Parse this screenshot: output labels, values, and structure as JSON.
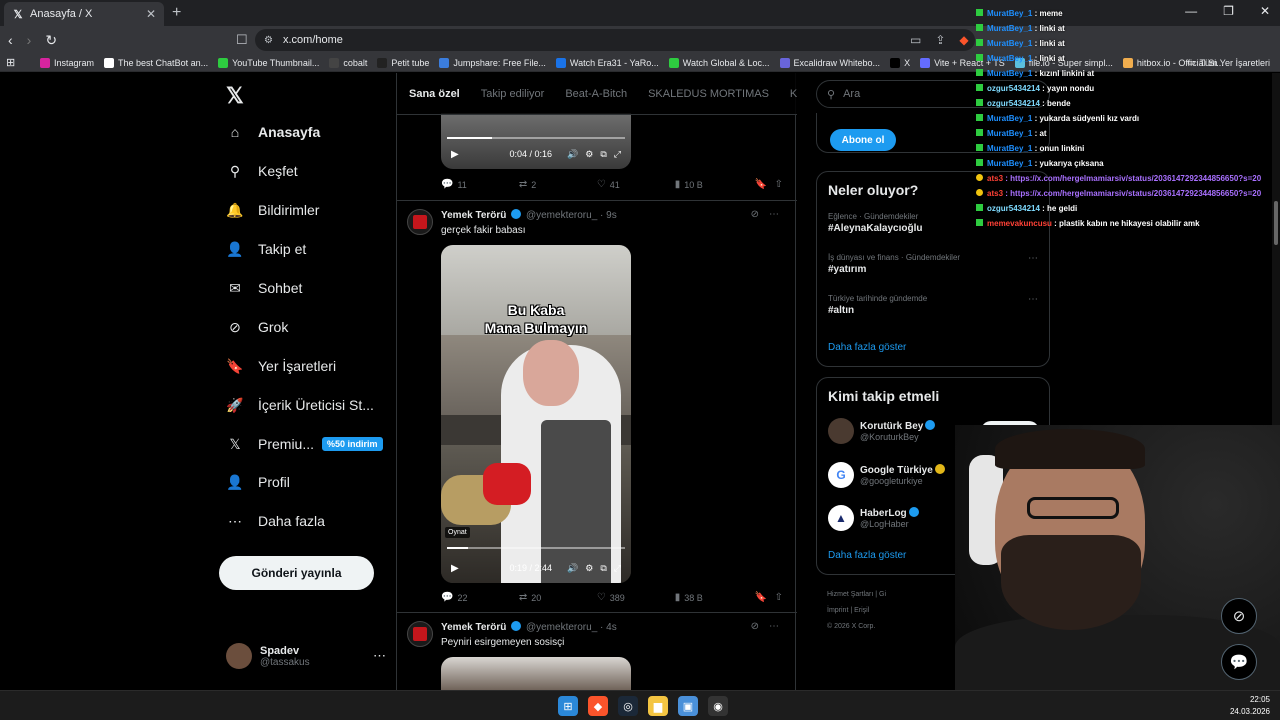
{
  "browser": {
    "tab_title": "Anasayfa / X",
    "url": "x.com/home",
    "bookmarks": [
      {
        "label": "Instagram",
        "color": "#d6249f"
      },
      {
        "label": "The best ChatBot an...",
        "color": "#ffffff"
      },
      {
        "label": "YouTube Thumbnail...",
        "color": "#2ecc40"
      },
      {
        "label": "cobalt",
        "color": "#444444"
      },
      {
        "label": "Petit tube",
        "color": "#222222"
      },
      {
        "label": "Jumpshare: Free File...",
        "color": "#3b7ddd"
      },
      {
        "label": "Watch Era31 - YaRo...",
        "color": "#1a73e8"
      },
      {
        "label": "Watch Global & Loc...",
        "color": "#2ecc40"
      },
      {
        "label": "Excalidraw Whitebo...",
        "color": "#6965db"
      },
      {
        "label": "X",
        "color": "#000000"
      },
      {
        "label": "Vite + React + TS",
        "color": "#646cff"
      },
      {
        "label": "file.io - Super simpl...",
        "color": "#5bc0de"
      },
      {
        "label": "hitbox.io - Official Si...",
        "color": "#f0ad4e"
      }
    ],
    "bookmarks_folder": "Tüm Yer İşaretleri"
  },
  "nav": {
    "items": [
      {
        "label": "Anasayfa",
        "icon": "home-icon",
        "glyph": "⌂"
      },
      {
        "label": "Keşfet",
        "icon": "search-icon",
        "glyph": "⚲"
      },
      {
        "label": "Bildirimler",
        "icon": "bell-icon",
        "glyph": "🔔"
      },
      {
        "label": "Takip et",
        "icon": "follow-icon",
        "glyph": "👤"
      },
      {
        "label": "Sohbet",
        "icon": "mail-icon",
        "glyph": "✉"
      },
      {
        "label": "Grok",
        "icon": "grok-icon",
        "glyph": "⊘"
      },
      {
        "label": "Yer İşaretleri",
        "icon": "bookmark-icon",
        "glyph": "🔖"
      },
      {
        "label": "İçerik Üreticisi St...",
        "icon": "rocket-icon",
        "glyph": "🚀"
      },
      {
        "label": "Premiu...",
        "icon": "x-premium-icon",
        "glyph": "𝕏"
      },
      {
        "label": "Profil",
        "icon": "profile-icon",
        "glyph": "👤"
      },
      {
        "label": "Daha fazla",
        "icon": "more-icon",
        "glyph": "⋯"
      }
    ],
    "premium_badge": "%50 indirim",
    "post_button": "Gönderi yayınla",
    "profile_name": "Spadev",
    "profile_handle": "@tassakus"
  },
  "feed": {
    "tabs": [
      "Sana özel",
      "Takip ediliyor",
      "Beat-A-Bitch",
      "SKALEDUS MORTIMAS",
      "Kend"
    ],
    "post1": {
      "video_time": "0:04 / 0:16",
      "progress": 0.25,
      "replies": "11",
      "reposts": "2",
      "likes": "41",
      "views": "10 B"
    },
    "post2": {
      "name": "Yemek Terörü",
      "handle": "@yemekteroru_",
      "time": "· 9s",
      "text": "gerçek fakir babası",
      "caption_line1": "Bu Kaba",
      "caption_line2": "Mana Bulmayın",
      "oynat": "Oynat",
      "video_time": "0:19 / 2:44",
      "progress": 0.12,
      "replies": "22",
      "reposts": "20",
      "likes": "389",
      "views": "38 B"
    },
    "post3": {
      "name": "Yemek Terörü",
      "handle": "@yemekteroru_",
      "time": "· 4s",
      "text": "Peyniri esirgemeyen sosisçi"
    }
  },
  "sidebar": {
    "search_placeholder": "Ara",
    "subscribe_button": "Abone ol",
    "trends_title": "Neler oluyor?",
    "trends": [
      {
        "category": "Eğlence · Gündemdekiler",
        "tag": "#AleynaKalaycıoğlu"
      },
      {
        "category": "İş dünyası ve finans · Gündemdekiler",
        "tag": "#yatırım"
      },
      {
        "category": "Türkiye tarihinde gündemde",
        "tag": "#altın"
      }
    ],
    "trends_more": "Daha fazla göster",
    "who_title": "Kimi takip etmeli",
    "who": [
      {
        "name": "Korutürk Bey",
        "handle": "@KoruturkBey"
      },
      {
        "name": "Google Türkiye",
        "handle": "@googleturkiye"
      },
      {
        "name": "HaberLog",
        "handle": "@LogHaber"
      }
    ],
    "follow_button": "Takip et",
    "who_more": "Daha fazla göster",
    "footer_line1": "Hizmet Şartları  |  Gi",
    "footer_line2": "İmprint  |  Erişil",
    "footer_line3": "© 2026 X Corp."
  },
  "chat": [
    {
      "user": "MuratBey_1",
      "msg": ": meme",
      "color": "#1e90ff"
    },
    {
      "user": "MuratBey_1",
      "msg": ": linki at",
      "color": "#1e90ff"
    },
    {
      "user": "MuratBey_1",
      "msg": ": linki at",
      "color": "#1e90ff"
    },
    {
      "user": "MuratBey_1",
      "msg": ": linki at",
      "color": "#1e90ff"
    },
    {
      "user": "MuratBey_1",
      "msg": ": kızınl linkini at",
      "color": "#1e90ff"
    },
    {
      "user": "ozgur5434214",
      "msg": ": yayın nondu",
      "color": "#7fdbff"
    },
    {
      "user": "ozgur5434214",
      "msg": ": bende",
      "color": "#7fdbff"
    },
    {
      "user": "MuratBey_1",
      "msg": ": yukarda südyenli kız vardı",
      "color": "#1e90ff"
    },
    {
      "user": "MuratBey_1",
      "msg": ": at",
      "color": "#1e90ff"
    },
    {
      "user": "MuratBey_1",
      "msg": ": onun linkini",
      "color": "#1e90ff"
    },
    {
      "user": "MuratBey_1",
      "msg": ": yukarıya çıksana",
      "color": "#1e90ff"
    },
    {
      "user": "ats3",
      "msg": ": https://x.com/hergelmamiarsiv/status/2036147292344856650?s=20",
      "color": "#ff4136",
      "link": true
    },
    {
      "user": "ats3",
      "msg": ": https://x.com/hergelmamiarsiv/status/2036147292344856650?s=20",
      "color": "#ff4136",
      "link": true
    },
    {
      "user": "ozgur5434214",
      "msg": ": he geldi",
      "color": "#7fdbff"
    },
    {
      "user": "memevakuncusu",
      "msg": ": plastik kabın ne hikayesi olabilir amk",
      "color": "#ff4136"
    }
  ],
  "taskbar": {
    "time": "22:05",
    "date": "24.03.2026"
  }
}
